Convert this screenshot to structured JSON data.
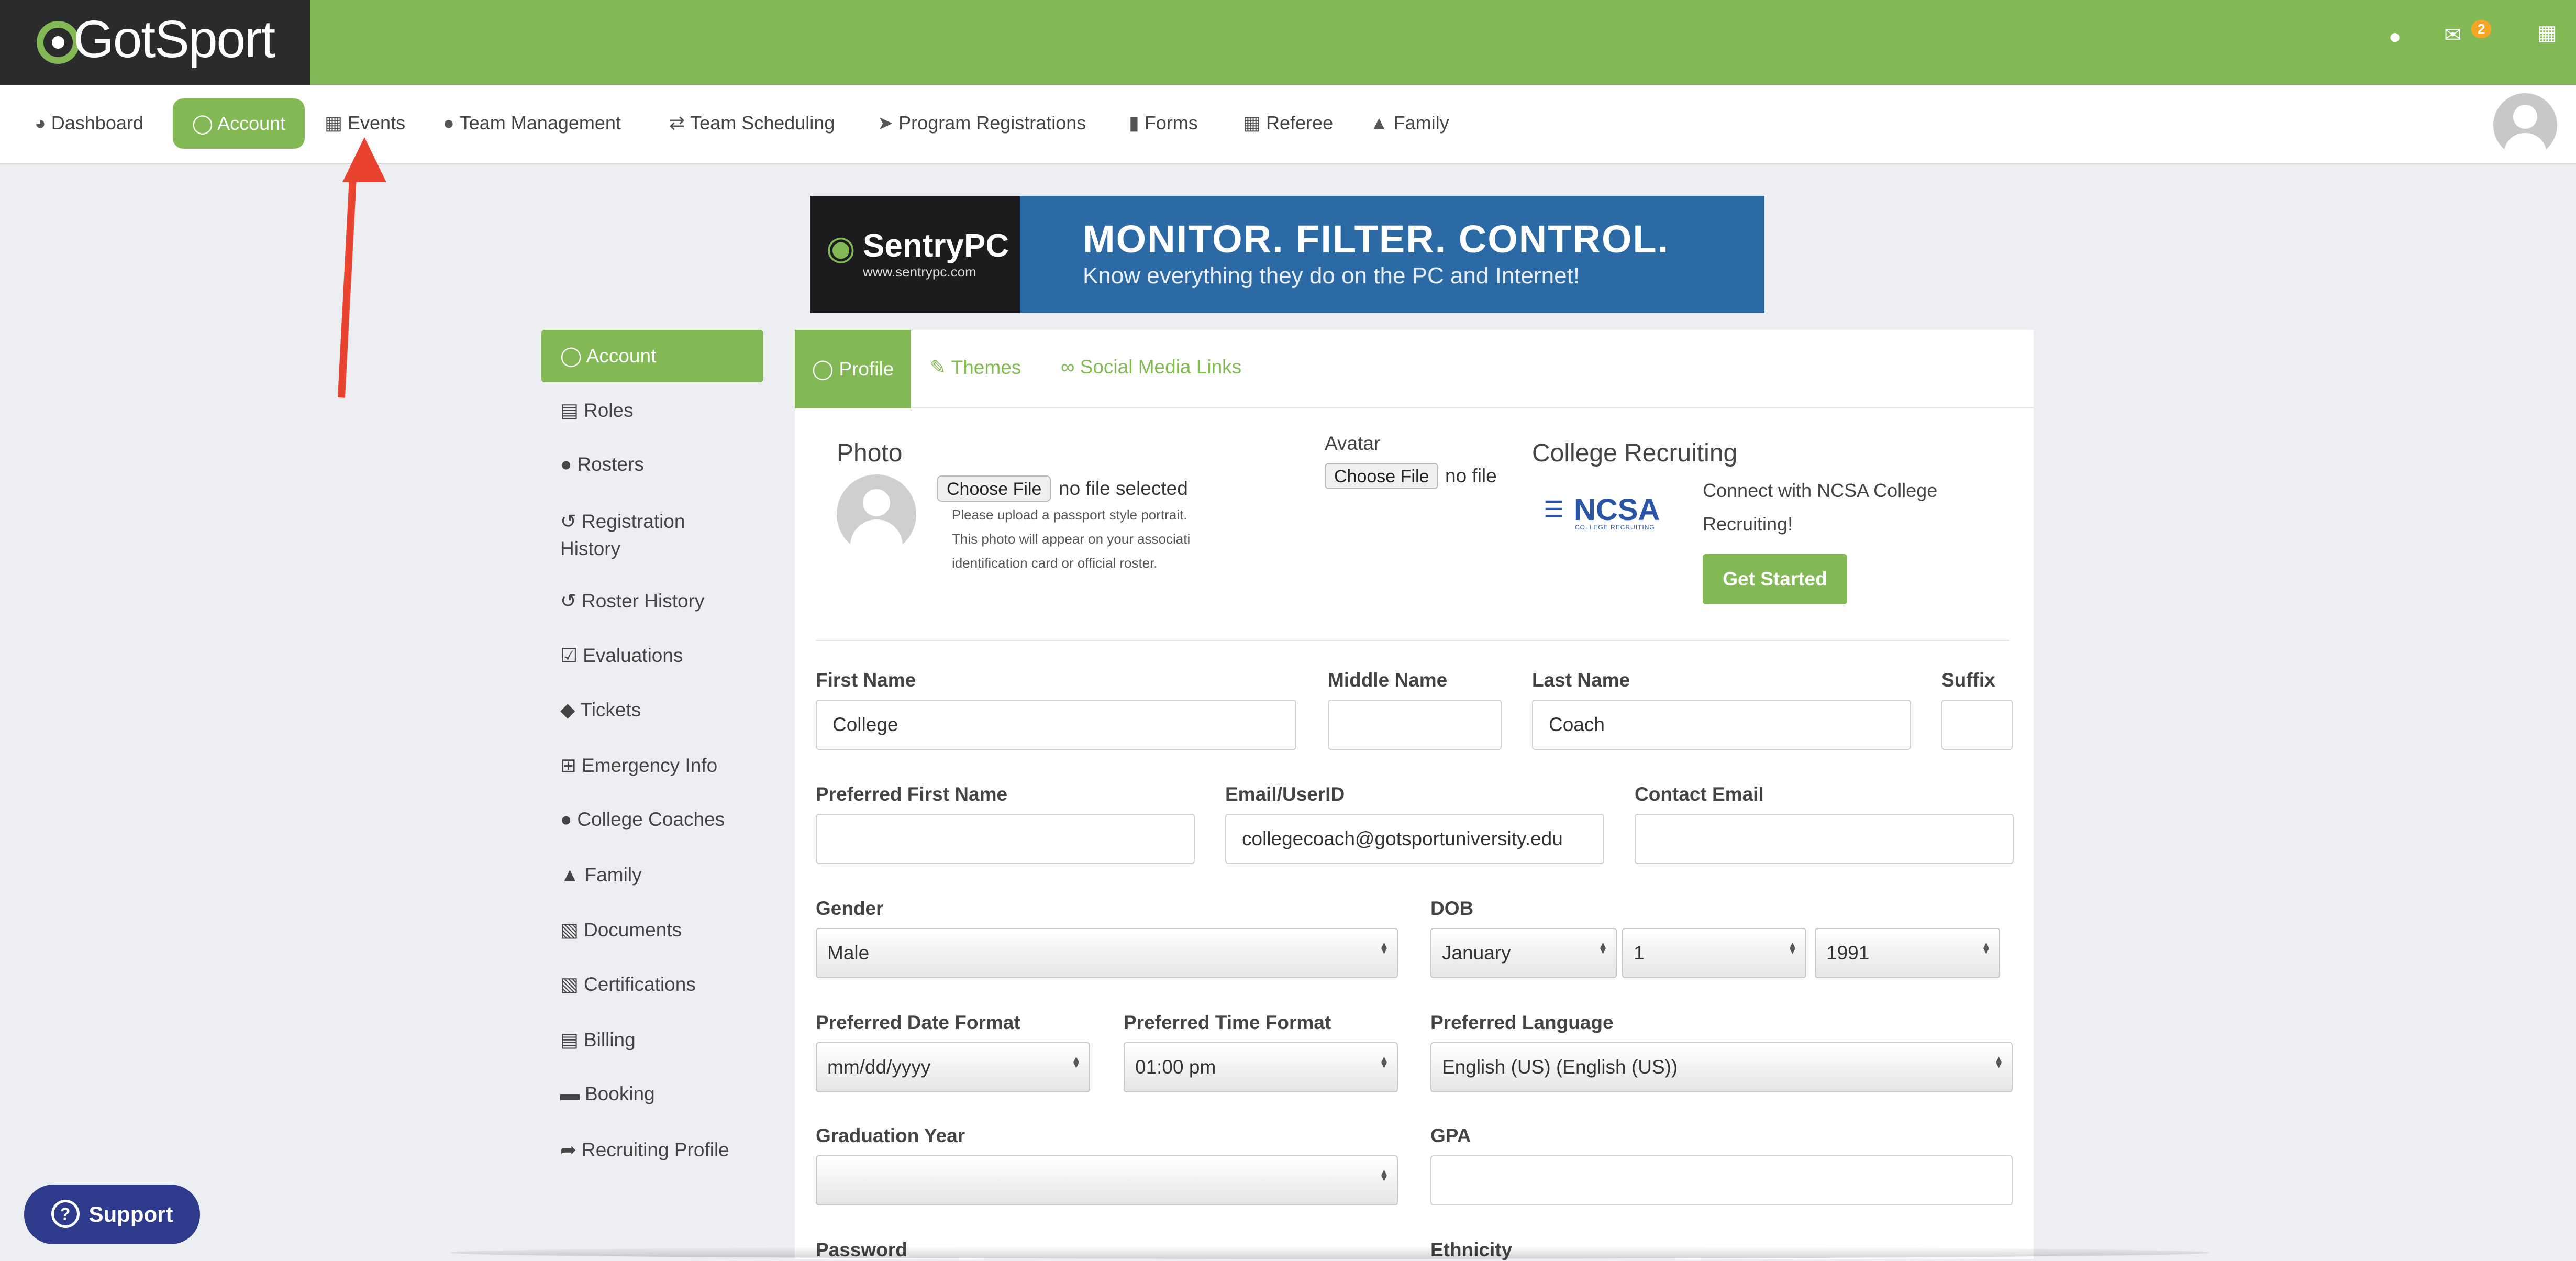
{
  "app": {
    "logo_text": "GotSport",
    "mail_badge": "2"
  },
  "nav": {
    "items": [
      {
        "label": "Dashboard",
        "icon": "dashboard-icon"
      },
      {
        "label": "Account",
        "icon": "user-circle-icon"
      },
      {
        "label": "Events",
        "icon": "calendar-icon"
      },
      {
        "label": "Team Management",
        "icon": "users-icon"
      },
      {
        "label": "Team Scheduling",
        "icon": "exchange-icon"
      },
      {
        "label": "Program Registrations",
        "icon": "paper-plane-icon"
      },
      {
        "label": "Forms",
        "icon": "file-icon"
      },
      {
        "label": "Referee",
        "icon": "calendar-icon"
      },
      {
        "label": "Family",
        "icon": "sitemap-icon"
      }
    ],
    "active": "Account"
  },
  "banner": {
    "brand": "SentryPC",
    "url": "www.sentrypc.com",
    "title": "MONITOR. FILTER. CONTROL.",
    "subtitle": "Know everything they do on the PC and Internet!"
  },
  "sidebar": {
    "items": [
      {
        "label": "Account",
        "icon": "user-circle-icon"
      },
      {
        "label": "Roles",
        "icon": "id-card-icon"
      },
      {
        "label": "Rosters",
        "icon": "users-icon"
      },
      {
        "label": "Registration History",
        "icon": "history-icon"
      },
      {
        "label": "Roster History",
        "icon": "history-icon"
      },
      {
        "label": "Evaluations",
        "icon": "calendar-check-icon"
      },
      {
        "label": "Tickets",
        "icon": "ticket-icon"
      },
      {
        "label": "Emergency Info",
        "icon": "plus-square-icon"
      },
      {
        "label": "College Coaches",
        "icon": "user-icon"
      },
      {
        "label": "Family",
        "icon": "sitemap-icon"
      },
      {
        "label": "Documents",
        "icon": "folder-open-icon"
      },
      {
        "label": "Certifications",
        "icon": "folder-open-icon"
      },
      {
        "label": "Billing",
        "icon": "credit-card-icon"
      },
      {
        "label": "Booking",
        "icon": "bed-icon"
      },
      {
        "label": "Recruiting Profile",
        "icon": "share-icon"
      }
    ],
    "registration_line1": "Registration",
    "registration_line2": "History"
  },
  "tabs": [
    {
      "label": "Profile",
      "icon": "user-circle-icon"
    },
    {
      "label": "Themes",
      "icon": "brush-icon"
    },
    {
      "label": "Social Media Links",
      "icon": "link-icon"
    }
  ],
  "photo": {
    "heading": "Photo",
    "button": "Choose File",
    "status": "no file selected",
    "hint1": "Please upload a passport style portrait.",
    "hint2": "This photo will appear on your associati",
    "hint3": "identification card or official roster."
  },
  "avatar": {
    "heading": "Avatar",
    "button": "Choose File",
    "status": "no file"
  },
  "recruiting": {
    "heading": "College Recruiting",
    "logo_text": "NCSA",
    "logo_sub": "COLLEGE RECRUITING",
    "text1": "Connect with NCSA College",
    "text2": "Recruiting!",
    "button": "Get Started"
  },
  "form": {
    "first_name_label": "First Name",
    "first_name": "College",
    "middle_name_label": "Middle Name",
    "middle_name": "",
    "last_name_label": "Last Name",
    "last_name": "Coach",
    "suffix_label": "Suffix",
    "suffix": "",
    "preferred_first_label": "Preferred First Name",
    "preferred_first": "",
    "email_label": "Email/UserID",
    "email": "collegecoach@gotsportuniversity.edu",
    "contact_email_label": "Contact Email",
    "contact_email": "",
    "gender_label": "Gender",
    "gender": "Male",
    "dob_label": "DOB",
    "dob_month": "January",
    "dob_day": "1",
    "dob_year": "1991",
    "date_format_label": "Preferred Date Format",
    "date_format": "mm/dd/yyyy",
    "time_format_label": "Preferred Time Format",
    "time_format": "01:00 pm",
    "language_label": "Preferred Language",
    "language": "English (US) (English (US))",
    "grad_year_label": "Graduation Year",
    "grad_year": "",
    "gpa_label": "GPA",
    "gpa": "",
    "password_label": "Password",
    "ethnicity_label": "Ethnicity"
  },
  "support": {
    "label": "Support"
  },
  "colors": {
    "brand_green": "#82b955",
    "dark": "#2a2b2d",
    "support_blue": "#2e3a8c",
    "arrow_red": "#e8442f"
  }
}
